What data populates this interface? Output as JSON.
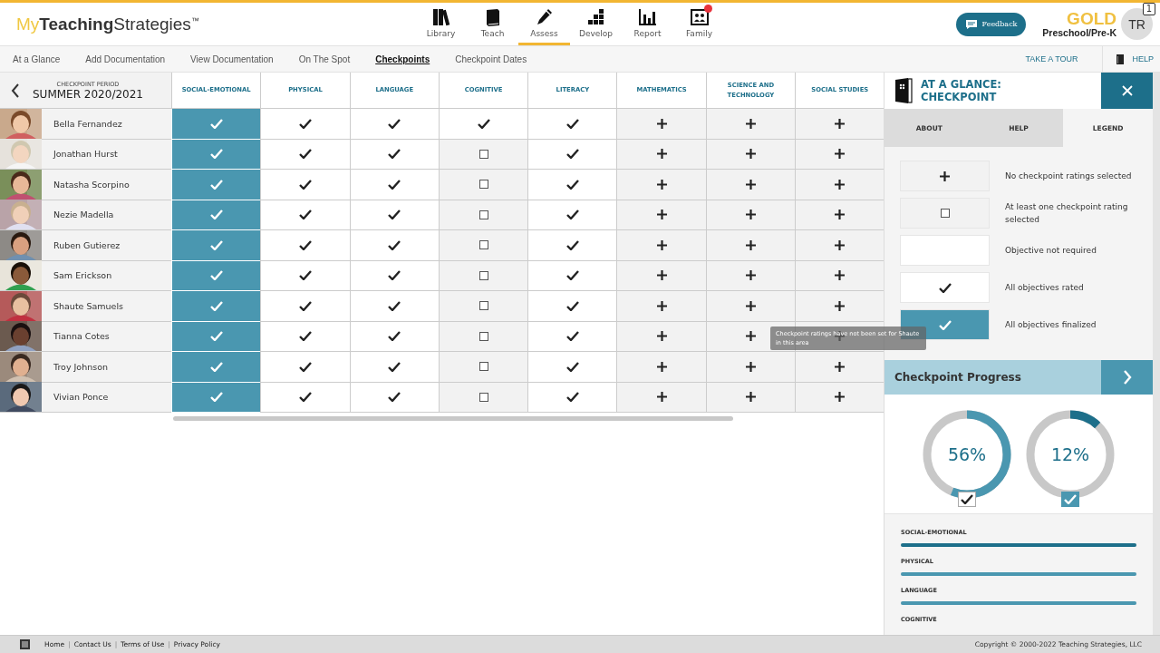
{
  "header": {
    "logo": [
      "My",
      "Teaching",
      "Strategies",
      "™"
    ],
    "nav": [
      {
        "label": "Library",
        "selected": false,
        "notification": false
      },
      {
        "label": "Teach",
        "selected": false,
        "notification": false
      },
      {
        "label": "Assess",
        "selected": true,
        "notification": false
      },
      {
        "label": "Develop",
        "selected": false,
        "notification": false
      },
      {
        "label": "Report",
        "selected": false,
        "notification": false
      },
      {
        "label": "Family",
        "selected": false,
        "notification": true
      }
    ],
    "feedback": "Feedback",
    "product": "GOLD",
    "product_sub": "Preschool/Pre-K",
    "avatar": "TR",
    "avatar_badge": "1"
  },
  "subnav": {
    "tabs": [
      {
        "label": "At a Glance",
        "selected": false
      },
      {
        "label": "Add Documentation",
        "selected": false
      },
      {
        "label": "View Documentation",
        "selected": false
      },
      {
        "label": "On The Spot",
        "selected": false
      },
      {
        "label": "Checkpoints",
        "selected": true
      },
      {
        "label": "Checkpoint Dates",
        "selected": false
      }
    ],
    "tour": "TAKE A TOUR",
    "help": "HELP"
  },
  "table": {
    "period_label": "CHECKPOINT PERIOD",
    "period": "SUMMER 2020/2021",
    "columns": [
      "SOCIAL-EMOTIONAL",
      "PHYSICAL",
      "LANGUAGE",
      "COGNITIVE",
      "LITERACY",
      "MATHEMATICS",
      "SCIENCE AND TECHNOLOGY",
      "SOCIAL STUDIES"
    ],
    "rows": [
      {
        "name": "Bella Fernandez",
        "cells": [
          {
            "kind": "finalized"
          },
          {
            "kind": "rated"
          },
          {
            "kind": "rated"
          },
          {
            "kind": "rated"
          },
          {
            "kind": "rated"
          },
          {
            "kind": "none"
          },
          {
            "kind": "none"
          },
          {
            "kind": "none"
          }
        ]
      },
      {
        "name": "Jonathan Hurst",
        "cells": [
          {
            "kind": "finalized"
          },
          {
            "kind": "rated"
          },
          {
            "kind": "rated"
          },
          {
            "kind": "partial"
          },
          {
            "kind": "rated"
          },
          {
            "kind": "none"
          },
          {
            "kind": "none"
          },
          {
            "kind": "none"
          }
        ]
      },
      {
        "name": "Natasha Scorpino",
        "cells": [
          {
            "kind": "finalized"
          },
          {
            "kind": "rated"
          },
          {
            "kind": "rated"
          },
          {
            "kind": "partial"
          },
          {
            "kind": "rated"
          },
          {
            "kind": "none"
          },
          {
            "kind": "none"
          },
          {
            "kind": "none"
          }
        ]
      },
      {
        "name": "Nezie Madella",
        "cells": [
          {
            "kind": "finalized"
          },
          {
            "kind": "rated"
          },
          {
            "kind": "rated"
          },
          {
            "kind": "partial"
          },
          {
            "kind": "rated"
          },
          {
            "kind": "none"
          },
          {
            "kind": "none"
          },
          {
            "kind": "none"
          }
        ]
      },
      {
        "name": "Ruben Gutierez",
        "cells": [
          {
            "kind": "finalized"
          },
          {
            "kind": "rated"
          },
          {
            "kind": "rated"
          },
          {
            "kind": "partial"
          },
          {
            "kind": "rated"
          },
          {
            "kind": "none"
          },
          {
            "kind": "none"
          },
          {
            "kind": "none"
          }
        ]
      },
      {
        "name": "Sam Erickson",
        "cells": [
          {
            "kind": "finalized"
          },
          {
            "kind": "rated"
          },
          {
            "kind": "rated"
          },
          {
            "kind": "partial"
          },
          {
            "kind": "rated"
          },
          {
            "kind": "none"
          },
          {
            "kind": "none"
          },
          {
            "kind": "none"
          }
        ]
      },
      {
        "name": "Shaute Samuels",
        "cells": [
          {
            "kind": "finalized"
          },
          {
            "kind": "rated"
          },
          {
            "kind": "rated"
          },
          {
            "kind": "partial"
          },
          {
            "kind": "rated"
          },
          {
            "kind": "none"
          },
          {
            "kind": "none"
          },
          {
            "kind": "none"
          }
        ]
      },
      {
        "name": "Tianna Cotes",
        "cells": [
          {
            "kind": "finalized"
          },
          {
            "kind": "rated"
          },
          {
            "kind": "rated"
          },
          {
            "kind": "partial"
          },
          {
            "kind": "rated"
          },
          {
            "kind": "none"
          },
          {
            "kind": "none"
          },
          {
            "kind": "none"
          }
        ]
      },
      {
        "name": "Troy Johnson",
        "cells": [
          {
            "kind": "finalized"
          },
          {
            "kind": "rated"
          },
          {
            "kind": "rated"
          },
          {
            "kind": "partial"
          },
          {
            "kind": "rated"
          },
          {
            "kind": "none"
          },
          {
            "kind": "none"
          },
          {
            "kind": "none"
          }
        ]
      },
      {
        "name": "Vivian Ponce",
        "cells": [
          {
            "kind": "finalized"
          },
          {
            "kind": "rated"
          },
          {
            "kind": "rated"
          },
          {
            "kind": "partial"
          },
          {
            "kind": "rated"
          },
          {
            "kind": "none"
          },
          {
            "kind": "none"
          },
          {
            "kind": "none"
          }
        ]
      }
    ],
    "tooltip": "Checkpoint ratings have not been set for Shaute in this area"
  },
  "panel": {
    "title": "AT A GLANCE: CHECKPOINT",
    "tabs": [
      {
        "label": "ABOUT",
        "selected": false
      },
      {
        "label": "HELP",
        "selected": false
      },
      {
        "label": "LEGEND",
        "selected": true
      }
    ],
    "legend": [
      {
        "kind": "none",
        "text": "No checkpoint ratings selected"
      },
      {
        "kind": "partial",
        "text": "At least one checkpoint rating selected"
      },
      {
        "kind": "blank",
        "text": "Objective not required"
      },
      {
        "kind": "rated",
        "text": "All objectives rated"
      },
      {
        "kind": "finalized",
        "text": "All objectives finalized"
      }
    ],
    "progress_title": "Checkpoint Progress",
    "donuts": [
      {
        "reading": "56%",
        "level": 0.56,
        "kind": "rated"
      },
      {
        "reading": "12%",
        "level": 0.12,
        "kind": "finalized"
      }
    ],
    "domains": [
      {
        "label": "SOCIAL-EMOTIONAL",
        "level": 1,
        "color": "#1d6f8a"
      },
      {
        "label": "PHYSICAL",
        "level": 1,
        "color": "#4a97b0"
      },
      {
        "label": "LANGUAGE",
        "level": 1,
        "color": "#4a97b0"
      },
      {
        "label": "COGNITIVE"
      }
    ]
  },
  "footer": {
    "links": [
      {
        "kind": "link",
        "text": "Home"
      },
      {
        "kind": "sep",
        "text": "|"
      },
      {
        "kind": "link",
        "text": "Contact Us"
      },
      {
        "kind": "sep",
        "text": "|"
      },
      {
        "kind": "link",
        "text": "Terms of Use"
      },
      {
        "kind": "sep",
        "text": "|"
      },
      {
        "kind": "link",
        "text": "Privacy Policy"
      }
    ],
    "copyright": "Copyright © 2000-2022 Teaching Strategies, LLC"
  }
}
